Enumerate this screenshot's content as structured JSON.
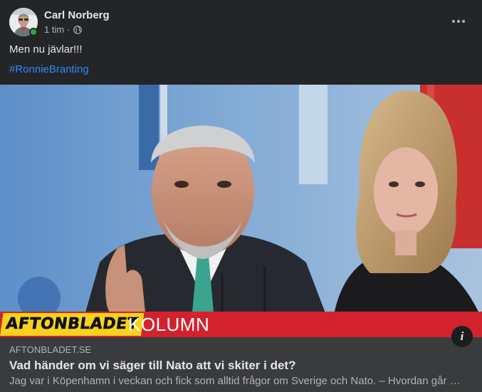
{
  "post": {
    "author": "Carl Norberg",
    "time": "1 tim",
    "separator": "·",
    "audience_icon": "globe-icon",
    "text": "Men nu jävlar!!!",
    "hashtag": "#RonnieBranting"
  },
  "link_preview": {
    "image_banner": {
      "brand": "AFTONBLADET",
      "label": "KOLUMN"
    },
    "info_icon": "i",
    "domain": "AFTONBLADET.SE",
    "title": "Vad händer om vi säger till Nato att vi skiter i det?",
    "description": "Jag var i Köpenhamn i veckan och fick som alltid frågor om Sverige och Nato. – Hvordan går …"
  },
  "colors": {
    "background": "#242526",
    "link_card": "#3a3b3c",
    "hashtag": "#2d88ff",
    "banner_red": "#d3222d",
    "banner_yellow": "#f8d21c",
    "online": "#31a24c"
  }
}
